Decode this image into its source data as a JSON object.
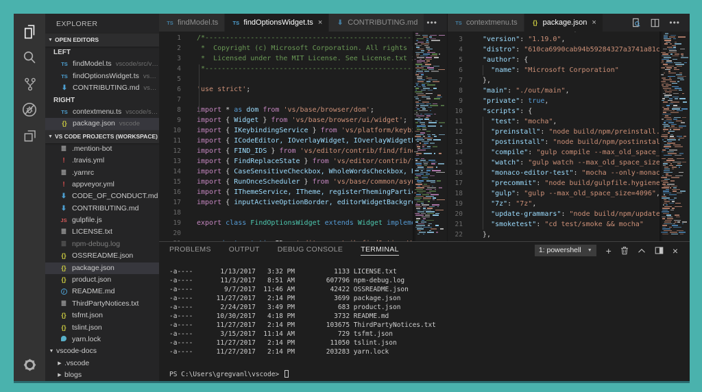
{
  "activity_bar": {
    "items": [
      {
        "name": "explorer",
        "active": true
      },
      {
        "name": "search",
        "active": false
      },
      {
        "name": "source-control",
        "active": false
      },
      {
        "name": "debug",
        "active": false
      },
      {
        "name": "extensions",
        "active": false
      }
    ],
    "bottom": {
      "name": "settings-gear"
    }
  },
  "sidebar": {
    "title": "EXPLORER",
    "open_editors": {
      "header": "OPEN EDITORS",
      "groups": [
        {
          "label": "LEFT",
          "items": [
            {
              "icon": "ts",
              "label": "findModel.ts",
              "path": "vscode/src/vs/..."
            },
            {
              "icon": "ts",
              "label": "findOptionsWidget.ts",
              "path": "vsco..."
            },
            {
              "icon": "md",
              "label": "CONTRIBUTING.md",
              "path": "vscode"
            }
          ]
        },
        {
          "label": "RIGHT",
          "items": [
            {
              "icon": "ts",
              "label": "contextmenu.ts",
              "path": "vscode/src/..."
            },
            {
              "icon": "json",
              "label": "package.json",
              "path": "vscode",
              "selected": true
            }
          ]
        }
      ]
    },
    "workspace": {
      "header": "VS CODE PROJECTS (WORKSPACE)",
      "items": [
        {
          "icon": "lines",
          "label": ".mention-bot",
          "indent": 1
        },
        {
          "icon": "warn",
          "label": ".travis.yml",
          "indent": 1
        },
        {
          "icon": "lines",
          "label": ".yarnrc",
          "indent": 1
        },
        {
          "icon": "warn",
          "label": "appveyor.yml",
          "indent": 1
        },
        {
          "icon": "md",
          "label": "CODE_OF_CONDUCT.md",
          "indent": 1
        },
        {
          "icon": "md",
          "label": "CONTRIBUTING.md",
          "indent": 1
        },
        {
          "icon": "gulp",
          "label": "gulpfile.js",
          "indent": 1
        },
        {
          "icon": "lines",
          "label": "LICENSE.txt",
          "indent": 1
        },
        {
          "icon": "log",
          "label": "npm-debug.log",
          "indent": 1,
          "dim": true
        },
        {
          "icon": "json",
          "label": "OSSREADME.json",
          "indent": 1
        },
        {
          "icon": "json",
          "label": "package.json",
          "indent": 1,
          "selected": true
        },
        {
          "icon": "json",
          "label": "product.json",
          "indent": 1
        },
        {
          "icon": "info",
          "label": "README.md",
          "indent": 1
        },
        {
          "icon": "lines",
          "label": "ThirdPartyNotices.txt",
          "indent": 1
        },
        {
          "icon": "json",
          "label": "tsfmt.json",
          "indent": 1
        },
        {
          "icon": "json",
          "label": "tslint.json",
          "indent": 1
        },
        {
          "icon": "yarn",
          "label": "yarn.lock",
          "indent": 1
        },
        {
          "arrow": "expanded",
          "label": "vscode-docs",
          "indent": 0,
          "folder": true
        },
        {
          "arrow": "collapsed",
          "label": ".vscode",
          "indent": 1,
          "folder": true
        },
        {
          "arrow": "collapsed",
          "label": "blogs",
          "indent": 1,
          "folder": true
        }
      ]
    }
  },
  "editor_left": {
    "tabs": [
      {
        "icon": "ts",
        "label": "findModel.ts",
        "active": false
      },
      {
        "icon": "ts",
        "label": "findOptionsWidget.ts",
        "active": true,
        "close": "×"
      },
      {
        "icon": "md",
        "label": "CONTRIBUTING.md",
        "active": false
      }
    ],
    "more_label": "•••",
    "first_line": 1,
    "lines": [
      [
        [
          "cm",
          "/*---------------------------------------------------------------------------------------------"
        ]
      ],
      [
        [
          "cm",
          " *  Copyright (c) Microsoft Corporation. All rights reserved."
        ]
      ],
      [
        [
          "cm",
          " *  Licensed under the MIT License. See License.txt in the project root for license information."
        ]
      ],
      [
        [
          "cm",
          " *--------------------------------------------------------------------------------------------*/"
        ]
      ],
      [],
      [
        [
          "str",
          "'use strict'"
        ],
        [
          "pn",
          ";"
        ]
      ],
      [],
      [
        [
          "kw",
          "import"
        ],
        [
          "pn",
          " * "
        ],
        [
          "kb",
          "as"
        ],
        [
          "id",
          " dom "
        ],
        [
          "kw",
          "from"
        ],
        [
          "str",
          " 'vs/base/browser/dom'"
        ],
        [
          "pn",
          ";"
        ]
      ],
      [
        [
          "kw",
          "import"
        ],
        [
          "pn",
          " { "
        ],
        [
          "id",
          "Widget"
        ],
        [
          "pn",
          " } "
        ],
        [
          "kw",
          "from"
        ],
        [
          "str",
          " 'vs/base/browser/ui/widget'"
        ],
        [
          "pn",
          ";"
        ]
      ],
      [
        [
          "kw",
          "import"
        ],
        [
          "pn",
          " { "
        ],
        [
          "id",
          "IKeybindingService"
        ],
        [
          "pn",
          " } "
        ],
        [
          "kw",
          "from"
        ],
        [
          "str",
          " 'vs/platform/keybinding/common/keybinding'"
        ],
        [
          "pn",
          ";"
        ]
      ],
      [
        [
          "kw",
          "import"
        ],
        [
          "pn",
          " { "
        ],
        [
          "id",
          "ICodeEditor, IOverlayWidget, IOverlayWidgetPosition"
        ],
        [
          "pn",
          " } "
        ],
        [
          "kw",
          "from"
        ],
        [
          "str",
          " 'vs/editor/browser/editorBrowser'"
        ],
        [
          "pn",
          ";"
        ]
      ],
      [
        [
          "kw",
          "import"
        ],
        [
          "pn",
          " { "
        ],
        [
          "id",
          "FIND_IDS"
        ],
        [
          "pn",
          " } "
        ],
        [
          "kw",
          "from"
        ],
        [
          "str",
          " 'vs/editor/contrib/find/findModel'"
        ],
        [
          "pn",
          ";"
        ]
      ],
      [
        [
          "kw",
          "import"
        ],
        [
          "pn",
          " { "
        ],
        [
          "id",
          "FindReplaceState"
        ],
        [
          "pn",
          " } "
        ],
        [
          "kw",
          "from"
        ],
        [
          "str",
          " 'vs/editor/contrib/find/findState'"
        ],
        [
          "pn",
          ";"
        ]
      ],
      [
        [
          "kw",
          "import"
        ],
        [
          "pn",
          " { "
        ],
        [
          "id",
          "CaseSensitiveCheckbox, WholeWordsCheckbox, RegexCheckbox"
        ],
        [
          "pn",
          " } "
        ],
        [
          "kw",
          "from"
        ],
        [
          "str",
          " 'vs/base/browser/ui/findinput/findInputCheckboxes'"
        ],
        [
          "pn",
          ";"
        ]
      ],
      [
        [
          "kw",
          "import"
        ],
        [
          "pn",
          " { "
        ],
        [
          "id",
          "RunOnceScheduler"
        ],
        [
          "pn",
          " } "
        ],
        [
          "kw",
          "from"
        ],
        [
          "str",
          " 'vs/base/common/async'"
        ],
        [
          "pn",
          ";"
        ]
      ],
      [
        [
          "kw",
          "import"
        ],
        [
          "pn",
          " { "
        ],
        [
          "id",
          "IThemeService, ITheme, registerThemingParticipant"
        ],
        [
          "pn",
          " } "
        ],
        [
          "kw",
          "from"
        ],
        [
          "str",
          " 'vs/platform/theme/common/themeService'"
        ],
        [
          "pn",
          ";"
        ]
      ],
      [
        [
          "kw",
          "import"
        ],
        [
          "pn",
          " { "
        ],
        [
          "id",
          "inputActiveOptionBorder, editorWidgetBackground, widgetShadow"
        ],
        [
          "pn",
          " } "
        ],
        [
          "kw",
          "from"
        ],
        [
          "str",
          " 'vs/platform/theme/common/colorRegistry'"
        ],
        [
          "pn",
          ";"
        ]
      ],
      [],
      [
        [
          "kw",
          "export"
        ],
        [
          "kb",
          " class "
        ],
        [
          "ty",
          "FindOptionsWidget"
        ],
        [
          "kb",
          " extends "
        ],
        [
          "ty",
          "Widget"
        ],
        [
          "kb",
          " implements "
        ],
        [
          "ty",
          "IOverlayWidget"
        ],
        [
          "pn",
          " {"
        ]
      ],
      [],
      [
        [
          "pn",
          "    "
        ],
        [
          "kb",
          "private static"
        ],
        [
          "pn",
          " ID = "
        ],
        [
          "str",
          "'editor.contrib.findOptionsWidget'"
        ],
        [
          "pn",
          ";"
        ]
      ]
    ]
  },
  "editor_right": {
    "tabs": [
      {
        "icon": "ts",
        "label": "contextmenu.ts",
        "active": false
      },
      {
        "icon": "json",
        "label": "package.json",
        "active": true,
        "close": "×"
      }
    ],
    "actions": [
      {
        "name": "open-preview"
      },
      {
        "name": "split-editor"
      },
      {
        "name": "more-actions"
      }
    ],
    "first_line": 2,
    "lines": [
      [
        [
          "key",
          "  \"name\""
        ],
        [
          "pn",
          ": "
        ],
        [
          "str",
          "\"code-oss-dev\""
        ],
        [
          "pn",
          ","
        ]
      ],
      [
        [
          "key",
          "  \"version\""
        ],
        [
          "pn",
          ": "
        ],
        [
          "str",
          "\"1.19.0\""
        ],
        [
          "pn",
          ","
        ]
      ],
      [
        [
          "key",
          "  \"distro\""
        ],
        [
          "pn",
          ": "
        ],
        [
          "str",
          "\"610ca6990cab94b59284327a3741a81c0e805b6a\""
        ],
        [
          "pn",
          ","
        ]
      ],
      [
        [
          "key",
          "  \"author\""
        ],
        [
          "pn",
          ": {"
        ]
      ],
      [
        [
          "key",
          "    \"name\""
        ],
        [
          "pn",
          ": "
        ],
        [
          "str",
          "\"Microsoft Corporation\""
        ]
      ],
      [
        [
          "pn",
          "  },"
        ]
      ],
      [
        [
          "key",
          "  \"main\""
        ],
        [
          "pn",
          ": "
        ],
        [
          "str",
          "\"./out/main\""
        ],
        [
          "pn",
          ","
        ]
      ],
      [
        [
          "key",
          "  \"private\""
        ],
        [
          "pn",
          ": "
        ],
        [
          "bool",
          "true"
        ],
        [
          "pn",
          ","
        ]
      ],
      [
        [
          "key",
          "  \"scripts\""
        ],
        [
          "pn",
          ": {"
        ]
      ],
      [
        [
          "key",
          "    \"test\""
        ],
        [
          "pn",
          ": "
        ],
        [
          "str",
          "\"mocha\""
        ],
        [
          "pn",
          ","
        ]
      ],
      [
        [
          "key",
          "    \"preinstall\""
        ],
        [
          "pn",
          ": "
        ],
        [
          "str",
          "\"node build/npm/preinstall.js\""
        ],
        [
          "pn",
          ","
        ]
      ],
      [
        [
          "key",
          "    \"postinstall\""
        ],
        [
          "pn",
          ": "
        ],
        [
          "str",
          "\"node build/npm/postinstall.js\""
        ],
        [
          "pn",
          ","
        ]
      ],
      [
        [
          "key",
          "    \"compile\""
        ],
        [
          "pn",
          ": "
        ],
        [
          "str",
          "\"gulp compile --max_old_space_size=4096\""
        ],
        [
          "pn",
          ","
        ]
      ],
      [
        [
          "key",
          "    \"watch\""
        ],
        [
          "pn",
          ": "
        ],
        [
          "str",
          "\"gulp watch --max_old_space_size=4096\""
        ],
        [
          "pn",
          ","
        ]
      ],
      [
        [
          "key",
          "    \"monaco-editor-test\""
        ],
        [
          "pn",
          ": "
        ],
        [
          "str",
          "\"mocha --only-monaco-editor\""
        ],
        [
          "pn",
          ","
        ]
      ],
      [
        [
          "key",
          "    \"precommit\""
        ],
        [
          "pn",
          ": "
        ],
        [
          "str",
          "\"node build/gulpfile.hygiene.js\""
        ],
        [
          "pn",
          ","
        ]
      ],
      [
        [
          "key",
          "    \"gulp\""
        ],
        [
          "pn",
          ": "
        ],
        [
          "str",
          "\"gulp --max_old_space_size=4096\""
        ],
        [
          "pn",
          ","
        ]
      ],
      [
        [
          "key",
          "    \"7z\""
        ],
        [
          "pn",
          ": "
        ],
        [
          "str",
          "\"7z\""
        ],
        [
          "pn",
          ","
        ]
      ],
      [
        [
          "key",
          "    \"update-grammars\""
        ],
        [
          "pn",
          ": "
        ],
        [
          "str",
          "\"node build/npm/update-all-grammars.js\""
        ],
        [
          "pn",
          ","
        ]
      ],
      [
        [
          "key",
          "    \"smoketest\""
        ],
        [
          "pn",
          ": "
        ],
        [
          "str",
          "\"cd test/smoke && mocha\""
        ]
      ],
      [
        [
          "pn",
          "  },"
        ]
      ]
    ]
  },
  "panel": {
    "tabs": [
      {
        "label": "PROBLEMS",
        "active": false
      },
      {
        "label": "OUTPUT",
        "active": false
      },
      {
        "label": "DEBUG CONSOLE",
        "active": false
      },
      {
        "label": "TERMINAL",
        "active": true
      }
    ],
    "shell_label": "1: powershell",
    "actions": [
      {
        "name": "new-terminal",
        "glyph": "+"
      },
      {
        "name": "kill-terminal",
        "glyph": "trash"
      },
      {
        "name": "maximize-panel",
        "glyph": "chevron-up"
      },
      {
        "name": "toggle-panel-position",
        "glyph": "panel"
      },
      {
        "name": "close-panel",
        "glyph": "×"
      }
    ],
    "rows": [
      {
        "mode": "-a----",
        "date": "1/13/2017",
        "time": "3:32 PM",
        "size": "1133",
        "name": "LICENSE.txt"
      },
      {
        "mode": "-a----",
        "date": "11/3/2017",
        "time": "8:51 AM",
        "size": "607796",
        "name": "npm-debug.log"
      },
      {
        "mode": "-a----",
        "date": "9/7/2017",
        "time": "11:46 AM",
        "size": "42422",
        "name": "OSSREADME.json"
      },
      {
        "mode": "-a----",
        "date": "11/27/2017",
        "time": "2:14 PM",
        "size": "3699",
        "name": "package.json"
      },
      {
        "mode": "-a----",
        "date": "2/24/2017",
        "time": "3:49 PM",
        "size": "683",
        "name": "product.json"
      },
      {
        "mode": "-a----",
        "date": "10/30/2017",
        "time": "4:18 PM",
        "size": "3732",
        "name": "README.md"
      },
      {
        "mode": "-a----",
        "date": "11/27/2017",
        "time": "2:14 PM",
        "size": "103675",
        "name": "ThirdPartyNotices.txt"
      },
      {
        "mode": "-a----",
        "date": "3/15/2017",
        "time": "11:14 AM",
        "size": "729",
        "name": "tsfmt.json"
      },
      {
        "mode": "-a----",
        "date": "11/27/2017",
        "time": "2:14 PM",
        "size": "11050",
        "name": "tslint.json"
      },
      {
        "mode": "-a----",
        "date": "11/27/2017",
        "time": "2:14 PM",
        "size": "203283",
        "name": "yarn.lock"
      }
    ],
    "prompt": "PS C:\\Users\\gregvanl\\vscode> "
  }
}
